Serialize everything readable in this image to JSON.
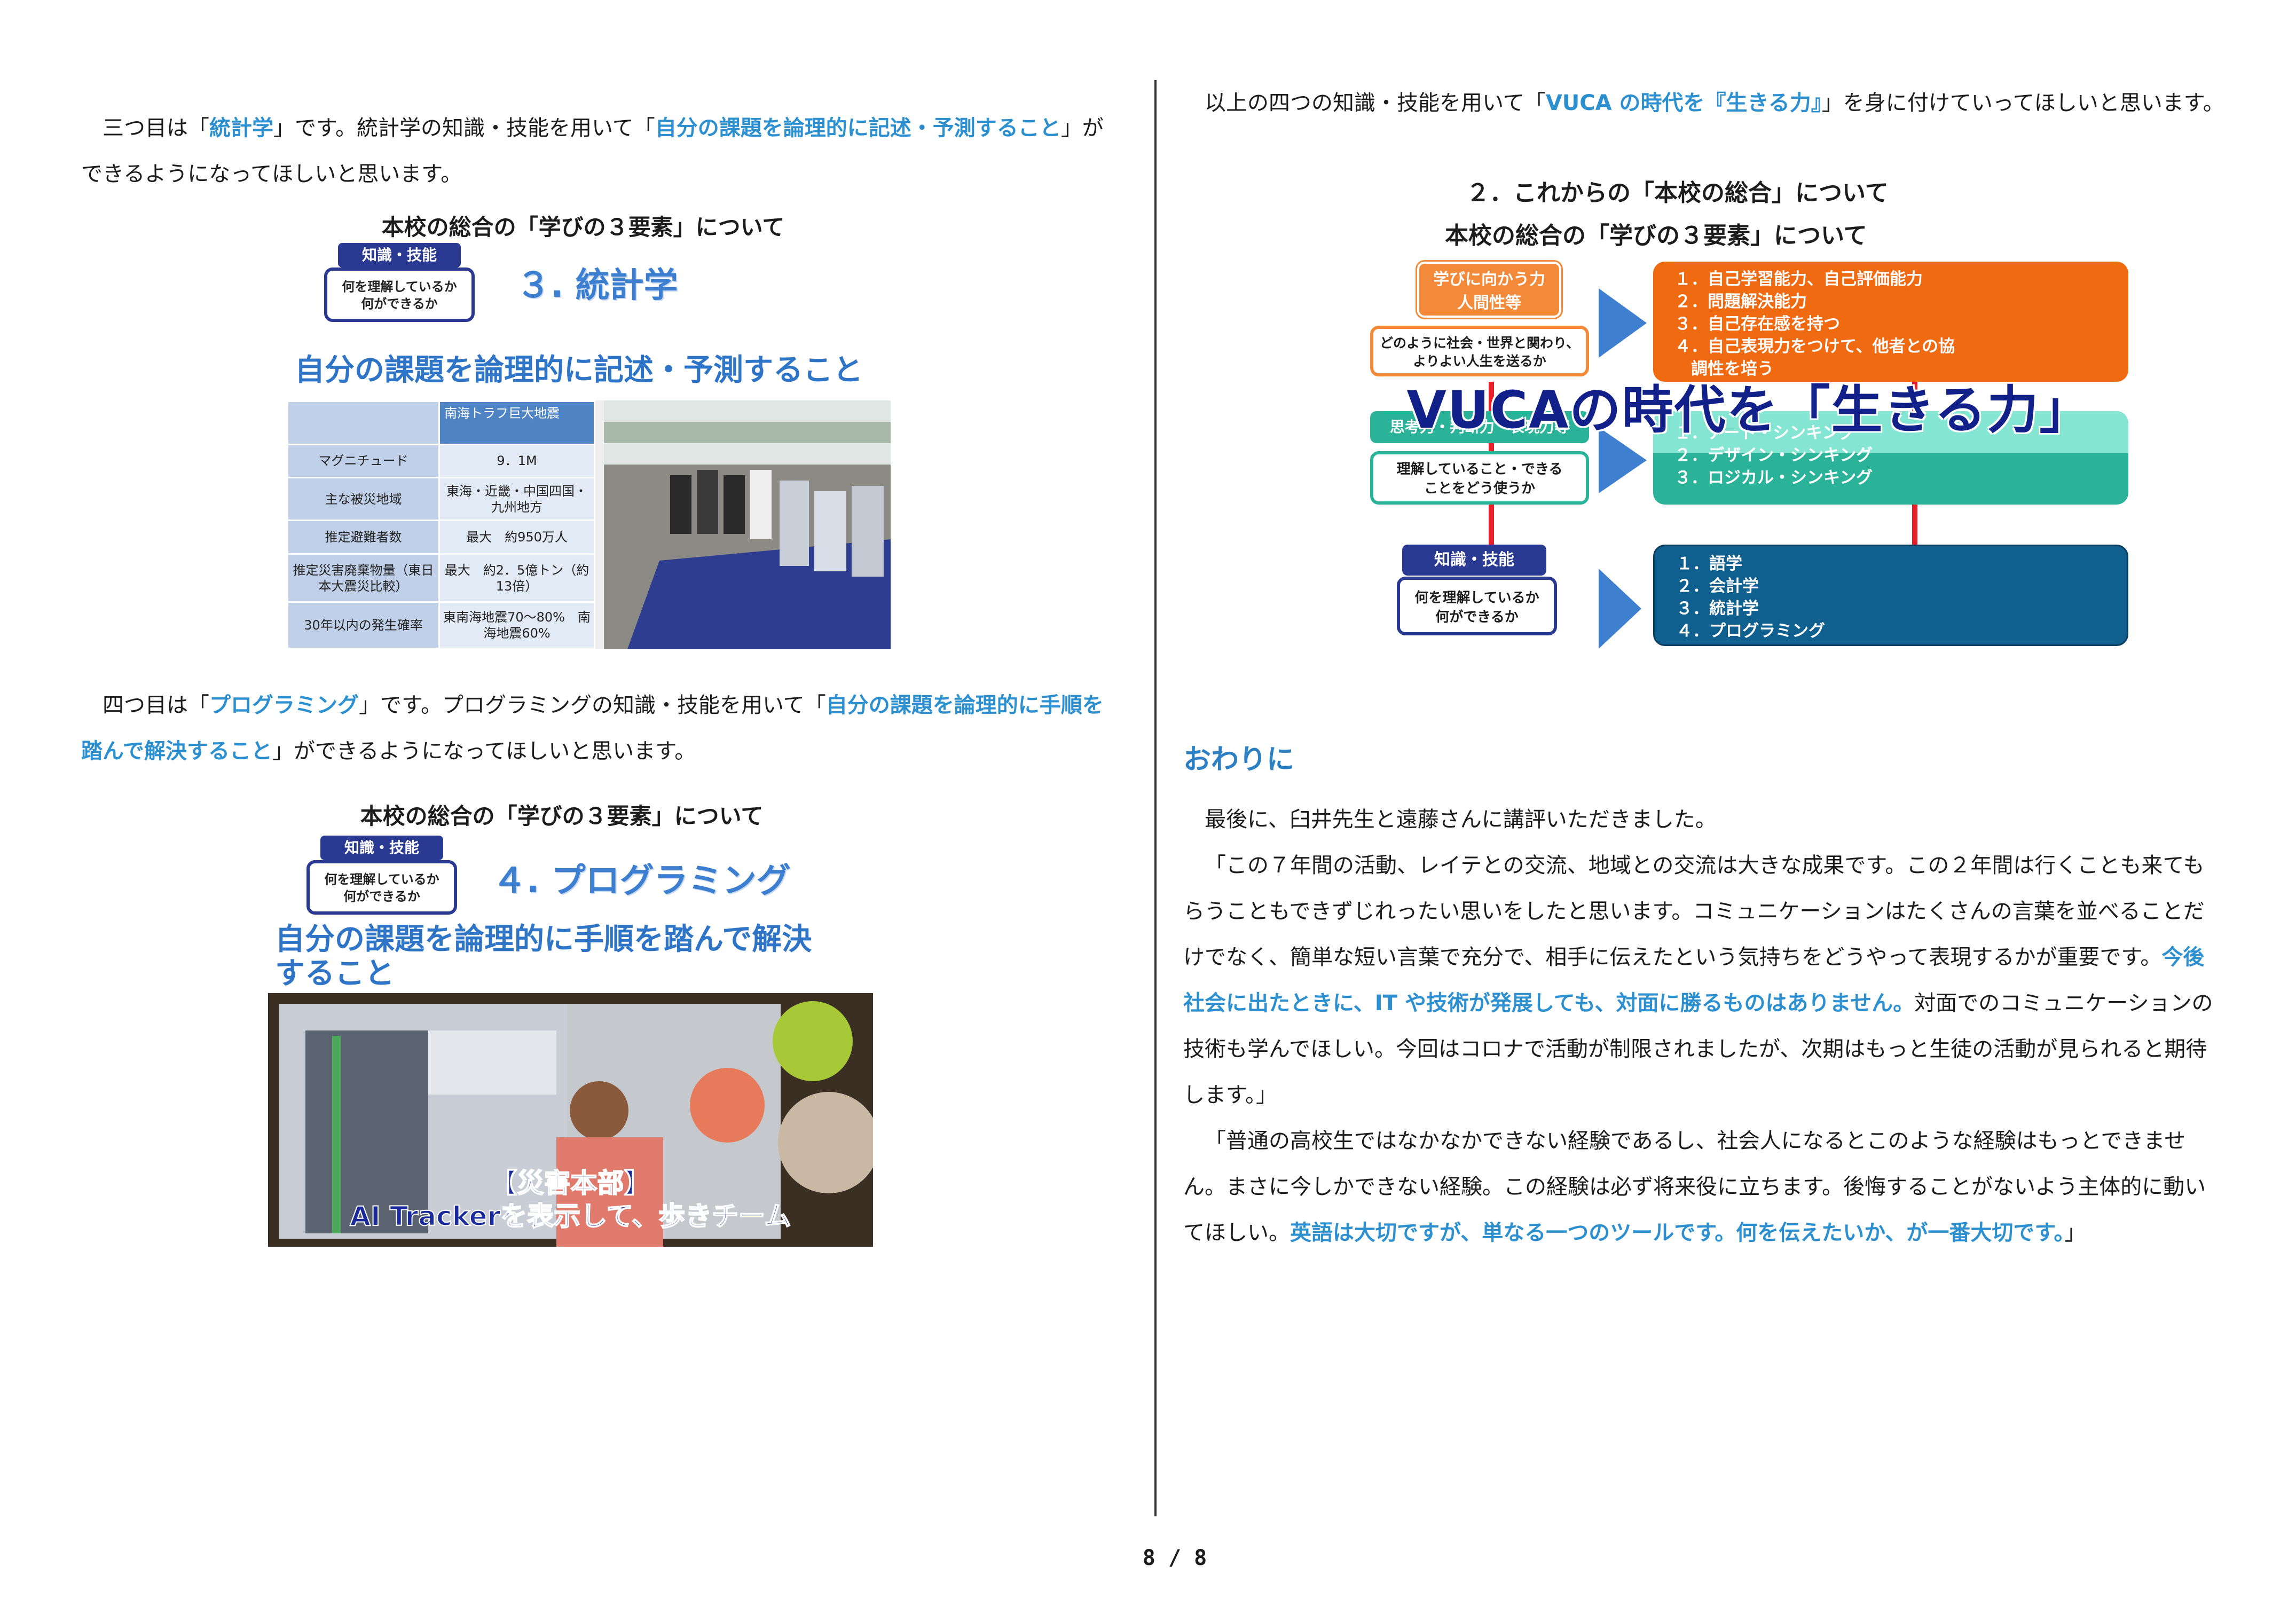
{
  "left": {
    "p1": {
      "t1": "三つ目は「",
      "h1": "統計学",
      "t2": "」です。統計学の知識・技能を用いて「",
      "h2": "自分の課題を論理的に記述・予測すること",
      "t3": "」ができるようになってほしいと思います。"
    },
    "slide1": {
      "title": "本校の総合の「学びの３要素」について",
      "badge_top": "知識・技能",
      "badge_l1": "何を理解しているか",
      "badge_l2": "何ができるか",
      "heading": "３. 統計学",
      "sub": "自分の課題を論理的に記述・予測すること",
      "table": {
        "header": "南海トラフ巨大地震",
        "rows": [
          {
            "label": "マグニチュード",
            "value": "9．1M"
          },
          {
            "label": "主な被災地域",
            "value": "東海・近畿・中国四国・九州地方"
          },
          {
            "label": "推定避難者数",
            "value": "最大　約950万人"
          },
          {
            "label": "推定災害廃棄物量（東日本大震災比較）",
            "value": "最大　約2．5億トン（約13倍）"
          },
          {
            "label": "30年以内の発生確率",
            "value": "東南海地震70～80%　南海地震60%"
          }
        ]
      }
    },
    "p2": {
      "t1": "四つ目は「",
      "h1": "プログラミング",
      "t2": "」です。プログラミングの知識・技能を用いて「",
      "h2": "自分の課題を論理的に手順を踏んで解決すること",
      "t3": "」ができるようになってほしいと思います。"
    },
    "slide2": {
      "title": "本校の総合の「学びの３要素」について",
      "badge_top": "知識・技能",
      "badge_l1": "何を理解しているか",
      "badge_l2": "何ができるか",
      "heading": "４. プログラミング",
      "sub1": "自分の課題を論理的に手順を踏んで解決",
      "sub2": "すること",
      "caption1": "【災害本部】",
      "caption2": "AI Trackerを表示して、歩きチーム"
    }
  },
  "right": {
    "p1": {
      "t1": "以上の四つの知識・技能を用いて「",
      "h1": "VUCA の時代を『生きる力』",
      "t2": "」を身に付けていってほしいと思います。"
    },
    "heading1": "２．これからの「本校の総合」について",
    "heading2": "本校の総合の「学びの３要素」について",
    "diagram": {
      "top_left_badge": "学びに向かう力\n人間性等",
      "top_left_box": "どのように社会・世界と関わり、\nよりよい人生を送るか",
      "top_items": [
        "１．自己学習能力、自己評価能力",
        "２．問題解決能力",
        "３．自己存在感を持つ",
        "４．自己表現力をつけて、他者との協",
        "　調性を培う"
      ],
      "overlay": "VUCAの時代を「生きる力」",
      "mid_left_badge": "思考力・判断力・表現力等",
      "mid_left_box": "理解していること・できる\nことをどう使うか",
      "mid_items": [
        "１．アート・シンキング",
        "２．デザイン・シンキング",
        "３．ロジカル・シンキング"
      ],
      "bot_left_badge": "知識・技能",
      "bot_left_box": "何を理解しているか\n何ができるか",
      "bot_items": [
        "１．語学",
        "２．会計学",
        "３．統計学",
        "４．プログラミング"
      ],
      "colors": {
        "top": "#f06a12",
        "mid": "#2bb39a",
        "bot": "#0f5f8f",
        "arrow": "#3f7fd0",
        "connector": "#e8202a"
      }
    },
    "section_title": "おわりに",
    "c1": "最後に、臼井先生と遠藤さんに講評いただきました。",
    "c2_t": "「この７年間の活動、レイテとの交流、地域との交流は大きな成果です。この２年間は行くことも来てもらうこともできずじれったい思いをしたと思います。コミュニケーションはたくさんの言葉を並べることだけでなく、簡単な短い言葉で充分で、相手に伝えたという気持ちをどうやって表現するかが重要です。",
    "c2_h": "今後社会に出たときに、IT や技術が発展しても、対面に勝るものはありません。",
    "c2_t2": "対面でのコミュニケーションの技術も学んでほしい。今回はコロナで活動が制限されましたが、次期はもっと生徒の活動が見られると期待します。」",
    "c3_t": "「普通の高校生ではなかなかできない経験であるし、社会人になるとこのような経験はもっとできません。まさに今しかできない経験。この経験は必ず将来役に立ちます。後悔することがないよう主体的に動いてほしい。",
    "c3_h": "英語は大切ですが、単なる一つのツールです。何を伝えたいか、が一番大切です。",
    "c3_t2": "」"
  },
  "footer": {
    "page": "8 / 8"
  }
}
